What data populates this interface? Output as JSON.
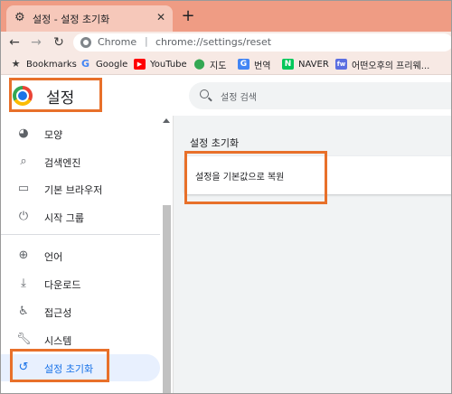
{
  "browser": {
    "tab_title": "설정 - 설정 초기화",
    "url_host": "Chrome",
    "url_path": "chrome://settings/reset"
  },
  "bookmarks": [
    {
      "label": "Bookmarks",
      "icon": "star-icon"
    },
    {
      "label": "Google",
      "icon": "google-icon"
    },
    {
      "label": "YouTube",
      "icon": "youtube-icon"
    },
    {
      "label": "지도",
      "icon": "maps-icon"
    },
    {
      "label": "번역",
      "icon": "translate-icon"
    },
    {
      "label": "NAVER",
      "icon": "naver-icon"
    },
    {
      "label": "어떤오후의 프리웨...",
      "icon": "site-icon"
    }
  ],
  "settings": {
    "title": "설정",
    "search_placeholder": "설정 검색"
  },
  "sidebar": {
    "items": [
      {
        "label": "모양",
        "icon": "palette-icon"
      },
      {
        "label": "검색엔진",
        "icon": "search-icon"
      },
      {
        "label": "기본 브라우저",
        "icon": "browser-icon"
      },
      {
        "label": "시작 그룹",
        "icon": "power-icon"
      },
      {
        "label": "언어",
        "icon": "globe-icon"
      },
      {
        "label": "다운로드",
        "icon": "download-icon"
      },
      {
        "label": "접근성",
        "icon": "accessibility-icon"
      },
      {
        "label": "시스템",
        "icon": "wrench-icon"
      },
      {
        "label": "설정 초기화",
        "icon": "restore-icon"
      }
    ]
  },
  "main": {
    "section_title": "설정 초기화",
    "reset_option": "설정을 기본값으로 복원"
  },
  "colors": {
    "highlight": "#e8702a",
    "tabstrip": "#ef9c84",
    "accent": "#1a73e8"
  }
}
